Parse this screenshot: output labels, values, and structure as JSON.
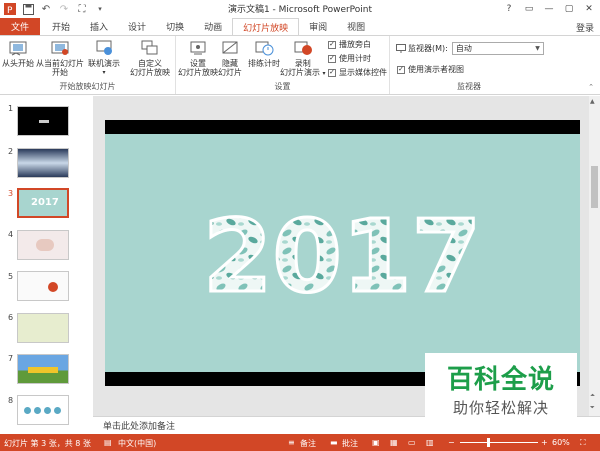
{
  "window": {
    "title": "演示文稿1 - Microsoft PowerPoint",
    "login": "登录",
    "controls": [
      "?",
      "▭",
      "—",
      "▢",
      "✕"
    ]
  },
  "tabs": [
    "文件",
    "开始",
    "插入",
    "设计",
    "切换",
    "动画",
    "幻灯片放映",
    "审阅",
    "视图"
  ],
  "ribbon": {
    "group1": {
      "label": "开始放映幻灯片",
      "btn_from_start": "从头开始",
      "btn_current_1": "从当前幻灯片",
      "btn_current_2": "开始",
      "btn_online": "联机演示",
      "btn_custom_1": "自定义",
      "btn_custom_2": "幻灯片放映"
    },
    "group2": {
      "label": "设置",
      "btn_setup_1": "设置",
      "btn_setup_2": "幻灯片放映",
      "btn_hide_1": "隐藏",
      "btn_hide_2": "幻灯片",
      "btn_rehearse": "排练计时",
      "btn_record_1": "录制",
      "btn_record_2": "幻灯片演示",
      "cb_narration": "播放旁白",
      "cb_timings": "使用计时",
      "cb_media": "显示媒体控件"
    },
    "group3": {
      "label": "监视器",
      "monitor_label": "监视器(M):",
      "monitor_value": "自动",
      "cb_presenter": "使用演示者视图"
    }
  },
  "thumbnails": [
    "1",
    "2",
    "3",
    "4",
    "5",
    "6",
    "7",
    "8"
  ],
  "slide": {
    "text": "2017"
  },
  "notes": {
    "placeholder": "单击此处添加备注"
  },
  "status": {
    "slide_info": "幻灯片 第 3 张，共 8 张",
    "language": "中文(中国)",
    "notes_btn": "备注",
    "comments_btn": "批注",
    "zoom": "60%"
  },
  "watermark": {
    "line1": "百科全说",
    "line2": "助你轻松解决"
  },
  "colors": {
    "accent": "#d24726",
    "slide_bg": "#a8d5cf",
    "watermark_green": "#1d9e4a"
  }
}
